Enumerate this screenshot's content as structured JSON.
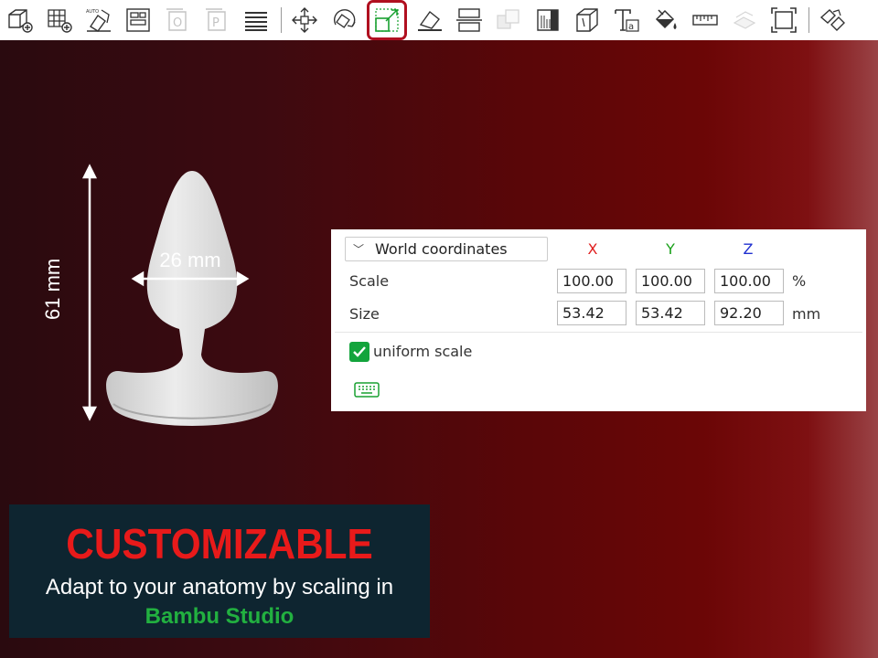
{
  "toolbar": {
    "items": [
      {
        "icon": "add-object-icon"
      },
      {
        "icon": "add-plate-icon"
      },
      {
        "icon": "auto-orient-icon",
        "badge": "AUTO"
      },
      {
        "icon": "arrange-icon"
      },
      {
        "icon": "split-objects-icon",
        "badge": "O",
        "disabled": true
      },
      {
        "icon": "split-parts-icon",
        "badge": "P",
        "disabled": true
      },
      {
        "icon": "variable-layer-height-icon"
      },
      {
        "icon": "move-icon"
      },
      {
        "icon": "rotate-icon"
      },
      {
        "icon": "scale-icon",
        "active": true
      },
      {
        "icon": "lay-on-face-icon"
      },
      {
        "icon": "cut-icon"
      },
      {
        "icon": "boolean-icon",
        "disabled": true
      },
      {
        "icon": "support-paint-icon"
      },
      {
        "icon": "seam-paint-icon"
      },
      {
        "icon": "text-emboss-icon",
        "badge": "a"
      },
      {
        "icon": "color-paint-icon"
      },
      {
        "icon": "measure-icon"
      },
      {
        "icon": "assembly-icon",
        "disabled": true
      },
      {
        "icon": "fit-view-icon"
      },
      {
        "icon": "assembly-view-icon"
      }
    ]
  },
  "model": {
    "height_label": "61 mm",
    "width_label": "26 mm",
    "body_color": "#e2e2e2"
  },
  "panel": {
    "coord_system": "World coordinates",
    "axes": {
      "x": "X",
      "y": "Y",
      "z": "Z"
    },
    "scale": {
      "label": "Scale",
      "x": "100.00",
      "y": "100.00",
      "z": "100.00",
      "unit": "%"
    },
    "size": {
      "label": "Size",
      "x": "53.42",
      "y": "53.42",
      "z": "92.20",
      "unit": "mm"
    },
    "uniform_scale": {
      "label": "uniform scale",
      "checked": true
    },
    "keyboard_icon": "keyboard-icon"
  },
  "promo": {
    "title": "CUSTOMIZABLE",
    "subtitle": "Adapt to your anatomy by scaling in",
    "brand": "Bambu Studio"
  },
  "colors": {
    "accent_red": "#e81a1a",
    "brand_green": "#22b040",
    "active_border": "#b01020",
    "axis_x": "#e02020",
    "axis_y": "#18a018",
    "axis_z": "#2030d0"
  }
}
